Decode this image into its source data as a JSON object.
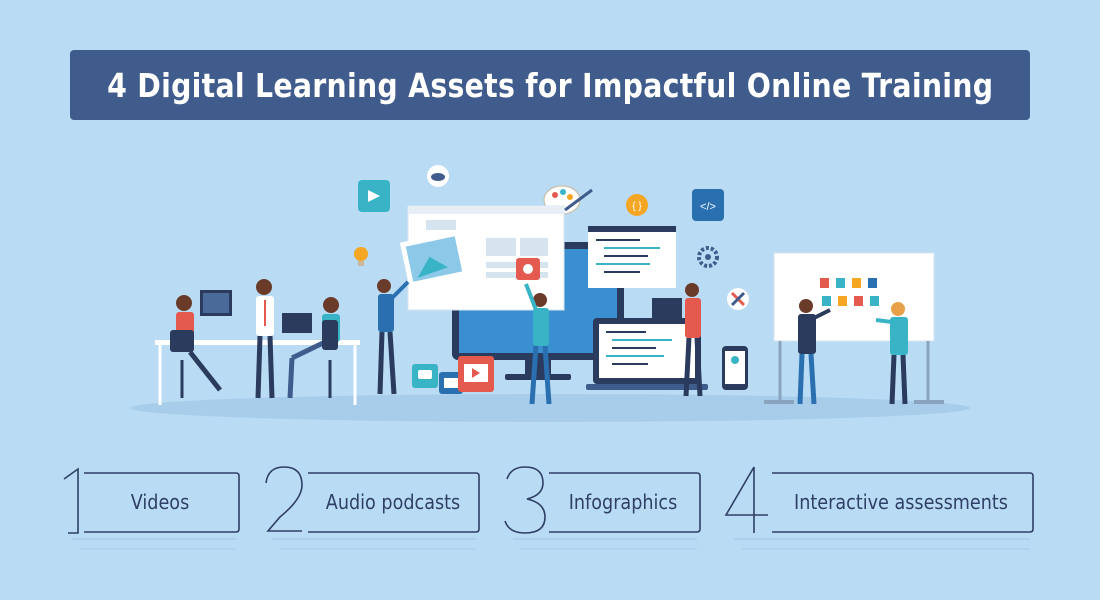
{
  "title": "4 Digital Learning Assets for Impactful Online Training",
  "colors": {
    "background": "#b9dcf4",
    "banner": "#3f5c8c",
    "outline": "#2f3f66",
    "accent_teal": "#39b4c6",
    "accent_red": "#e45a4f",
    "accent_orange": "#f5a623"
  },
  "assets": [
    {
      "number": "1",
      "label": "Videos"
    },
    {
      "number": "2",
      "label": "Audio podcasts"
    },
    {
      "number": "3",
      "label": "Infographics"
    },
    {
      "number": "4",
      "label": "Interactive assessments"
    }
  ],
  "illustration_icons": [
    "video-camera-icon",
    "cloud-icon",
    "paint-palette-icon",
    "code-icon",
    "settings-gear-icon",
    "lightbulb-icon",
    "image-icon",
    "chat-bubble-icon",
    "email-icon",
    "play-icon",
    "tools-icon",
    "brackets-icon"
  ]
}
